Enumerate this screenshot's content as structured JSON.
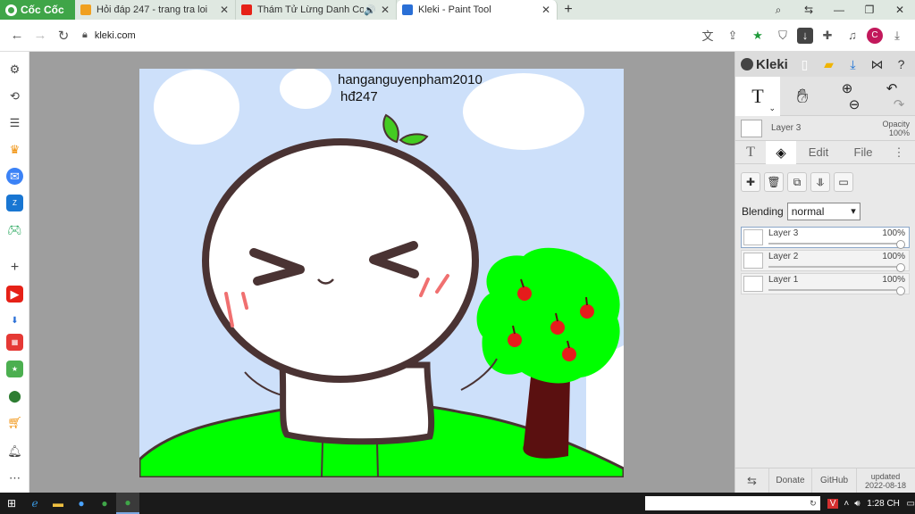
{
  "browser": {
    "brand": "Cốc Cốc",
    "tabs": [
      {
        "title": "Hỏi đáp 247 - trang tra loi",
        "favicon_color": "#f0a020",
        "active": false
      },
      {
        "title": "Thám Tử Lừng Danh Con",
        "favicon_color": "#e62117",
        "active": false,
        "audio": true
      },
      {
        "title": "Kleki - Paint Tool",
        "favicon_color": "#2a6fd6",
        "active": true
      }
    ],
    "new_tab": "+",
    "url": "kleki.com"
  },
  "canvas": {
    "lines": [
      "hanganguyenpham2010",
      "hđ247"
    ],
    "colors": {
      "sky": "#cde0fa",
      "grass": "#00ff00",
      "outline": "#4a3333",
      "tree_leaves": "#00ff00",
      "trunk": "#5a1010",
      "apple": "#e51c1c",
      "sprout": "#44cc22"
    }
  },
  "panel": {
    "brand": "Kleki",
    "current_layer": {
      "name": "Layer 3",
      "opacity_label": "Opacity",
      "opacity": "100%"
    },
    "subtabs": [
      {
        "label": "",
        "icon": "text-tool-icon"
      },
      {
        "label": "",
        "icon": "layers-icon",
        "active": true
      },
      {
        "label": "Edit"
      },
      {
        "label": "File"
      }
    ],
    "blending_label": "Blending",
    "blending_value": "normal",
    "layers": [
      {
        "name": "Layer 3",
        "opacity": "100%",
        "active": true
      },
      {
        "name": "Layer 2",
        "opacity": "100%",
        "active": false
      },
      {
        "name": "Layer 1",
        "opacity": "100%",
        "active": false
      }
    ],
    "footer": {
      "donate": "Donate",
      "github": "GitHub",
      "updated_label": "updated",
      "updated_date": "2022-08-18"
    }
  },
  "taskbar": {
    "clock": "1:28 CH"
  }
}
